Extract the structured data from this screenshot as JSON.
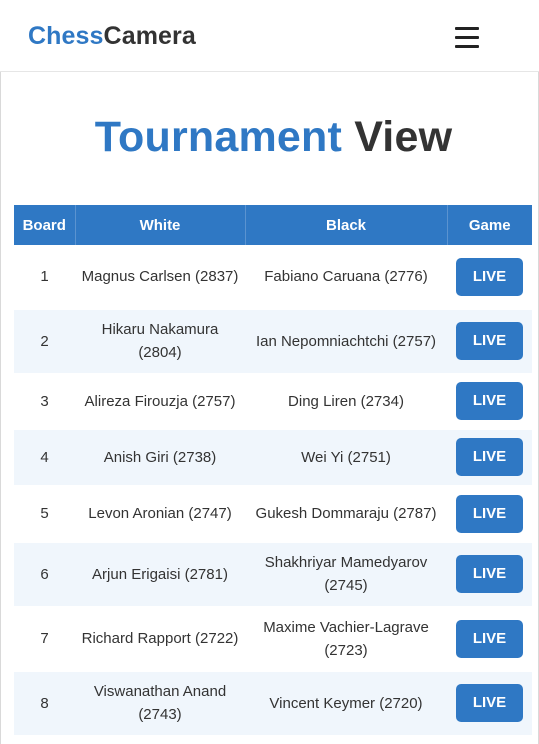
{
  "brand": {
    "part1": "Chess",
    "part2": "Camera"
  },
  "page_title": {
    "part1": "Tournament",
    "part2": "View"
  },
  "table": {
    "headers": [
      "Board",
      "White",
      "Black",
      "Game"
    ],
    "rows": [
      {
        "board": "1",
        "white": "Magnus Carlsen (2837)",
        "black": "Fabiano Caruana (2776)",
        "game": "LIVE"
      },
      {
        "board": "2",
        "white": "Hikaru Nakamura (2804)",
        "black": "Ian Nepomniachtchi (2757)",
        "game": "LIVE"
      },
      {
        "board": "3",
        "white": "Alireza Firouzja (2757)",
        "black": "Ding Liren (2734)",
        "game": "LIVE"
      },
      {
        "board": "4",
        "white": "Anish Giri (2738)",
        "black": "Wei Yi (2751)",
        "game": "LIVE"
      },
      {
        "board": "5",
        "white": "Levon Aronian (2747)",
        "black": "Gukesh Dommaraju (2787)",
        "game": "LIVE"
      },
      {
        "board": "6",
        "white": "Arjun Erigaisi (2781)",
        "black": "Shakhriyar Mamedyarov (2745)",
        "game": "LIVE"
      },
      {
        "board": "7",
        "white": "Richard Rapport (2722)",
        "black": "Maxime Vachier-Lagrave (2723)",
        "game": "LIVE"
      },
      {
        "board": "8",
        "white": "Viswanathan Anand (2743)",
        "black": "Vincent Keymer (2720)",
        "game": "LIVE"
      }
    ]
  },
  "colors": {
    "accent": "#2f78c4",
    "text": "#333333",
    "stripe": "#f0f6fc"
  },
  "icons": {
    "menu": "hamburger-menu-icon"
  }
}
